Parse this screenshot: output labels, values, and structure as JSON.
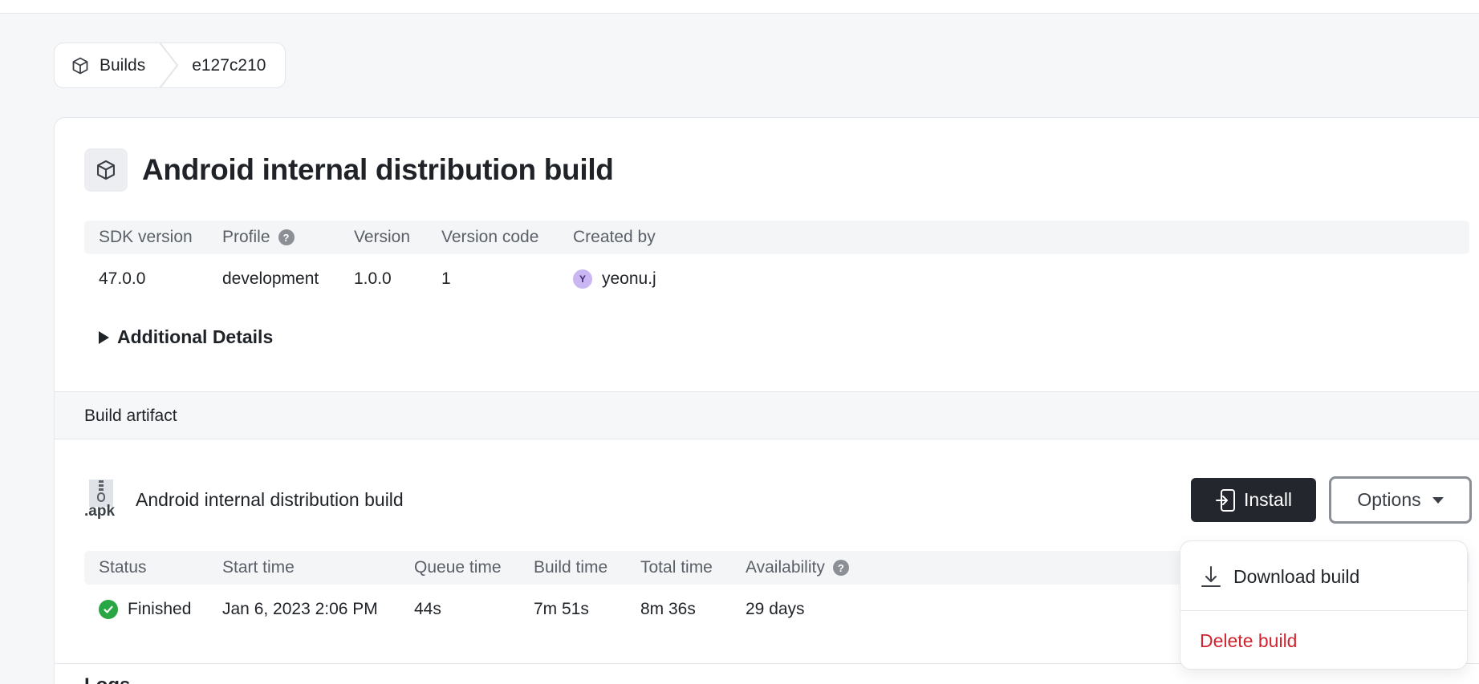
{
  "breadcrumb": {
    "items": [
      {
        "label": "Builds",
        "icon": "cube-icon"
      },
      {
        "label": "e127c210"
      }
    ]
  },
  "build": {
    "title": "Android internal distribution build",
    "meta_headers": {
      "sdk_version": "SDK version",
      "profile": "Profile",
      "version": "Version",
      "version_code": "Version code",
      "created_by": "Created by"
    },
    "meta_values": {
      "sdk_version": "47.0.0",
      "profile": "development",
      "version": "1.0.0",
      "version_code": "1",
      "created_by_initial": "Y",
      "created_by": "yeonu.j"
    },
    "help_glyph": "?",
    "additional_details_label": "Additional Details"
  },
  "artifact": {
    "section_title": "Build artifact",
    "file_ext": ".apk",
    "name": "Android internal distribution build",
    "install_label": "Install",
    "options_label": "Options",
    "status_headers": {
      "status": "Status",
      "start_time": "Start time",
      "queue_time": "Queue time",
      "build_time": "Build time",
      "total_time": "Total time",
      "availability": "Availability"
    },
    "status_values": {
      "status": "Finished",
      "start_time": "Jan 6, 2023 2:06 PM",
      "queue_time": "44s",
      "build_time": "7m 51s",
      "total_time": "8m 36s",
      "availability": "29 days"
    }
  },
  "logs": {
    "title": "Logs"
  },
  "options_menu": {
    "download_label": "Download build",
    "delete_label": "Delete build"
  },
  "colors": {
    "install_bg": "#23272d",
    "delete_text": "#d1242f",
    "status_success": "#2aa745",
    "avatar_bg": "#c9b6f2"
  }
}
